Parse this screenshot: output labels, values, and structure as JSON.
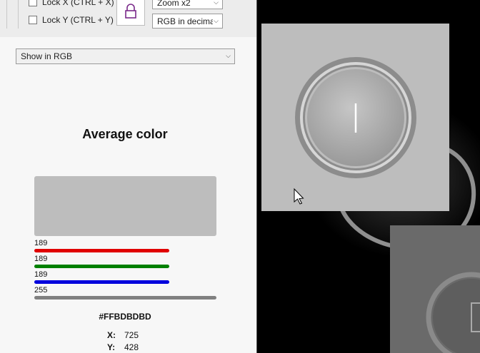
{
  "toolbar": {
    "lock_x_label": "Lock X (CTRL + X)",
    "lock_y_label": "Lock Y (CTRL + Y)",
    "zoom_value": "Zoom x2",
    "format_value": "RGB in decimal"
  },
  "display_mode": {
    "value": "Show in RGB"
  },
  "average": {
    "title": "Average color",
    "swatch_color": "#BDBDBD",
    "channels": [
      {
        "name": "red",
        "value": "189",
        "fraction": 0.741,
        "color": "#e00000"
      },
      {
        "name": "green",
        "value": "189",
        "fraction": 0.741,
        "color": "#008000"
      },
      {
        "name": "blue",
        "value": "189",
        "fraction": 0.741,
        "color": "#0000dd"
      },
      {
        "name": "alpha",
        "value": "255",
        "fraction": 1.0,
        "color": "#808080"
      }
    ],
    "hex": "#FFBDBDBD",
    "x_label": "X:",
    "x_value": "725",
    "y_label": "Y:",
    "y_value": "428"
  },
  "icons": {
    "lock": "lock-icon",
    "cursor": "mouse-cursor-icon",
    "chevron": "chevron-down-icon"
  }
}
